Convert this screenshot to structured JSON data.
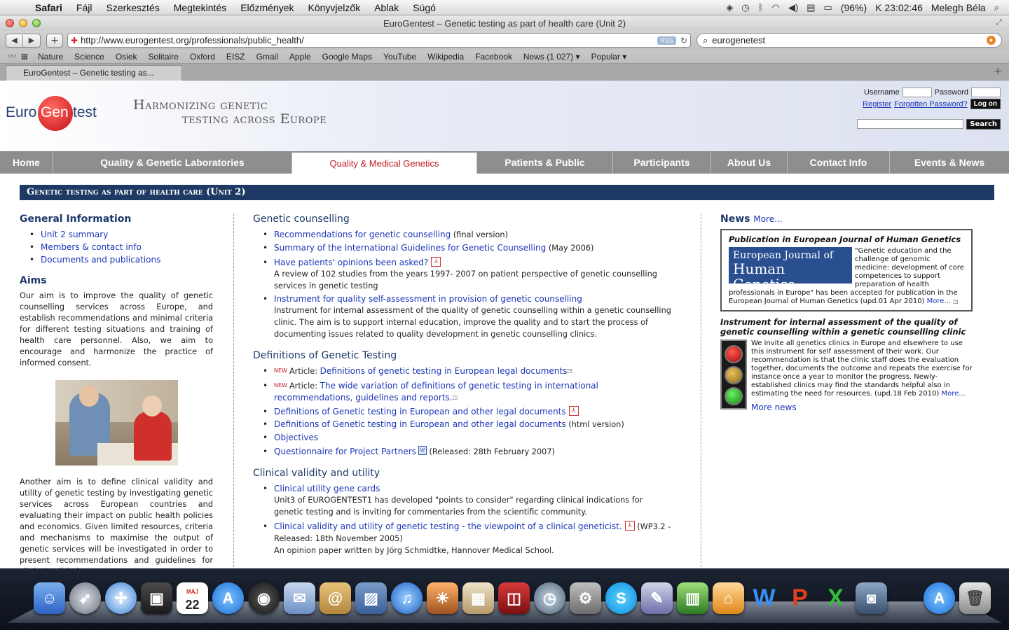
{
  "menubar": {
    "items": [
      "Safari",
      "Fájl",
      "Szerkesztés",
      "Megtekintés",
      "Előzmények",
      "Könyvjelzők",
      "Ablak",
      "Súgó"
    ],
    "battery": "(96%)",
    "clock": "K 23:02:46",
    "user": "Melegh Béla"
  },
  "window": {
    "title": "EuroGentest – Genetic testing as part of health care (Unit 2)",
    "url": "http://www.eurogentest.org/professionals/public_health/",
    "rss": "RSS",
    "search_query": "eurogenetest",
    "tab_label": "EuroGentest – Genetic testing as..."
  },
  "bookmarks": [
    "Nature",
    "Science",
    "Osiek",
    "Solitaire",
    "Oxford",
    "EISZ",
    "Gmail",
    "Apple",
    "Google Maps",
    "YouTube",
    "Wikipedia",
    "Facebook",
    "News (1 027) ▾",
    "Popular ▾"
  ],
  "header": {
    "logo_left": "Euro",
    "logo_mid": "Gen",
    "logo_right": "test",
    "tagline_line1": "Harmonizing genetic",
    "tagline_line2": "testing across Europe",
    "username_label": "Username",
    "password_label": "Password",
    "register": "Register",
    "forgot": "Forgotten Password?",
    "login_btn": "Log on",
    "search_btn": "Search"
  },
  "nav": [
    "Home",
    "Quality & Genetic Laboratories",
    "Quality & Medical Genetics",
    "Patients & Public",
    "Participants",
    "About Us",
    "Contact Info",
    "Events & News"
  ],
  "banner": "Genetic testing as part of health care (Unit 2)",
  "left": {
    "general_title": "General Information",
    "general_links": [
      "Unit 2 summary",
      "Members & contact info",
      "Documents and publications"
    ],
    "aims_title": "Aims",
    "aims_text": "Our aim is to improve the quality of genetic counselling services across Europe, and establish recommendations and minimal criteria for different testing situations and training of health care personnel. Also, we aim to encourage and harmonize the practice of informed consent.",
    "aims_text2": "Another aim is to define clinical validity and utility of genetic testing by investigating genetic services across European countries and evaluating their impact on public health policies and economics. Given limited resources, criteria and mechanisms to maximise the output of genetic services will be investigated in order to present recommendations and guidelines for clinical validation."
  },
  "middle": {
    "gc_title": "Genetic counselling",
    "gc_1_link": "Recommendations for genetic counselling",
    "gc_1_note": " (final version)",
    "gc_2_link": "Summary of the International Guidelines for Genetic Counselling",
    "gc_2_note": " (May 2006)",
    "gc_3_link": "Have patients' opinions been asked?",
    "gc_3_desc": "A review of 102 studies from the years 1997- 2007 on patient perspective of genetic counselling services in genetic testing",
    "gc_4_link": "Instrument for quality self-assessment in provision of genetic counselling",
    "gc_4_desc": "Instrument for internal assessment of the quality of genetic counselling within a genetic counselling clinic. The aim is to support internal education, improve the quality and to start the process of documenting issues related to quality development in genetic counselling clinics.",
    "def_title": "Definitions of Genetic Testing",
    "new_tag": "NEW",
    "def_1_prefix": "Article: ",
    "def_1_link": "Definitions of genetic testing in European legal documents",
    "def_2_prefix": "Article: ",
    "def_2_link": "The wide variation of definitions of genetic testing in international recommendations, guidelines and reports.",
    "def_3_link": "Definitions of Genetic testing in European and other legal documents",
    "def_4_link": "Definitions of Genetic testing in European and other legal documents",
    "def_4_note": " (html version)",
    "def_5_link": "Objectives",
    "def_6_link": "Questionnaire for Project Partners",
    "def_6_note": " (Released: 28th February 2007)",
    "cv_title": "Clinical validity and utility",
    "cv_1_link": "Clinical utility gene cards",
    "cv_1_desc": "Unit3 of EUROGENTEST1 has developed \"points to consider\" regarding clinical indications for genetic testing and is inviting for commentaries from the scientific community.",
    "cv_2_link": "Clinical validity and utility of genetic testing - the viewpoint of a clinical geneticist.",
    "cv_2_note": " (WP3.2 - Released: 18th November 2005)",
    "cv_2_desc": "An opinion paper written by Jörg Schmidtke, Hannover Medical School."
  },
  "right": {
    "news_title": "News",
    "news_more": "More...",
    "pub_title": "Publication in European Journal of Human Genetics",
    "ejhg_line1": "European Journal of",
    "ejhg_line2": "Human Genetics",
    "pub_text": "\"Genetic education and the challenge of genomic medicine: development of core competences to support preparation of health professionals in Europe\" has been accepted for publication in the European Journal of Human Genetics (upd.01 Apr 2010)",
    "pub_more": "More...",
    "inst_title": "Instrument for internal assessment of the quality of genetic counselling within a genetic counselling clinic",
    "inst_text": "We invite all genetics clinics in Europe and elsewhere to use this instrument for self assessment of their work. Our recommendation is that the clinic staff does the evaluation together, documents the outcome and repeats the exercise for instance once a year to monitor the progress. Newly-established clinics may find the standards helpful also in estimating the need for resources. (upd.18 Feb 2010)",
    "inst_more": "More...",
    "more_news": "More news"
  },
  "dock": {
    "calendar_day": "22",
    "calendar_month": "MÁJ"
  },
  "colors": {
    "nav_bg": "#8e8e8e",
    "nav_active_text": "#c21a22",
    "banner_bg": "#1e3963",
    "link": "#1a36b8",
    "heading": "#1c3a6b"
  }
}
